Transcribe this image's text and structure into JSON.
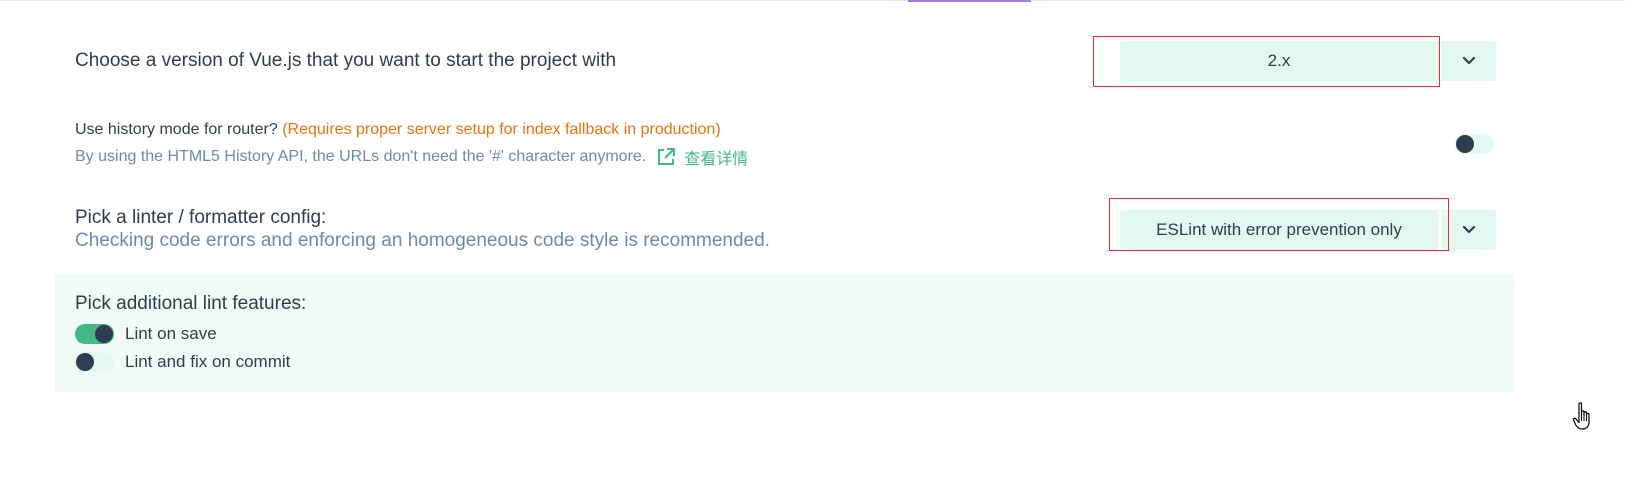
{
  "vue_version": {
    "label": "Choose a version of Vue.js that you want to start the project with",
    "selected": "2.x",
    "dropdown_icon": "chevron-down-icon"
  },
  "history_mode": {
    "question": "Use history mode for router?",
    "warning": "(Requires proper server setup for index fallback in production)",
    "description": "By using the HTML5 History API, the URLs don't need the '#' character anymore.",
    "link_icon": "external-link-icon",
    "link_text": "查看详情",
    "enabled": false
  },
  "linter": {
    "label": "Pick a linter / formatter config:",
    "description": "Checking code errors and enforcing an homogeneous code style is recommended.",
    "selected": "ESLint with error prevention only",
    "dropdown_icon": "chevron-down-icon"
  },
  "lint_features": {
    "title": "Pick additional lint features:",
    "items": [
      {
        "label": "Lint on save",
        "enabled": true
      },
      {
        "label": "Lint and fix on commit",
        "enabled": false
      }
    ]
  },
  "colors": {
    "accent": "#42b983",
    "accent_light": "#e3f8ee",
    "text": "#2c3e50",
    "muted": "#6a8bad",
    "warning": "#e8730d",
    "highlight_box": "#e8283a"
  }
}
